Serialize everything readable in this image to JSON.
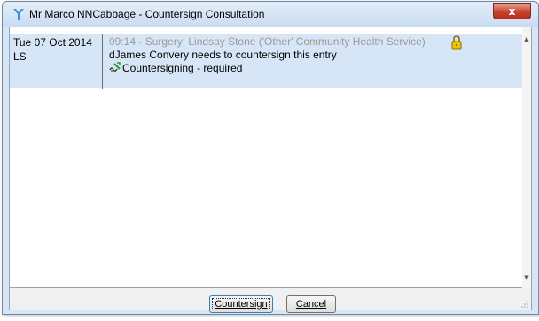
{
  "window": {
    "title": "Mr Marco NNCabbage - Countersign Consultation",
    "close_label": "x"
  },
  "entry": {
    "date": "Tue 07 Oct 2014",
    "initials": "LS",
    "header": "09:14 - Surgery: Lindsay Stone ('Other' Community Health Service)",
    "body": "dJames Convery needs to countersign this entry",
    "status": "Countersigning - required"
  },
  "buttons": {
    "countersign": "Countersign",
    "cancel": "Cancel"
  },
  "colors": {
    "selected_row": "#d6e6f6",
    "header_text": "#9a9a9a"
  },
  "icons": {
    "app": "emis-logo-icon",
    "countersign": "countersign-icon",
    "lock": "padlock-icon"
  }
}
